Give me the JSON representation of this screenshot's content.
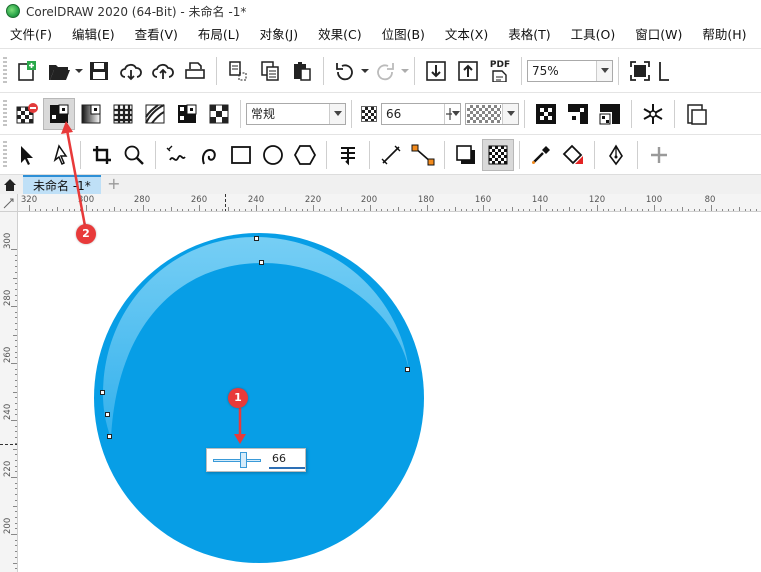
{
  "window": {
    "title": "CorelDRAW 2020 (64-Bit) - 未命名 -1*"
  },
  "menu": [
    "文件(F)",
    "编辑(E)",
    "查看(V)",
    "布局(L)",
    "对象(J)",
    "效果(C)",
    "位图(B)",
    "文本(X)",
    "表格(T)",
    "工具(O)",
    "窗口(W)",
    "帮助(H)"
  ],
  "standard_toolbar": {
    "zoom_value": "75%",
    "pdf_label": "PDF"
  },
  "property_bar": {
    "blend_mode": "常规",
    "opacity_value": "66"
  },
  "document": {
    "tab_label": "未命名 -1*"
  },
  "rulers": {
    "horizontal": [
      "320",
      "300",
      "280",
      "260",
      "240",
      "220",
      "200",
      "180",
      "160",
      "140",
      "120",
      "100",
      "80"
    ],
    "vertical": [
      "300",
      "280",
      "260",
      "240",
      "220",
      "200"
    ]
  },
  "transparency_slider": {
    "value": "66",
    "fraction": 0.66
  },
  "annotations": [
    {
      "number": "1"
    },
    {
      "number": "2"
    }
  ],
  "colors": {
    "circle_fill": "#079ee6",
    "highlight": "#5cc3f2",
    "badge": "#e83a3a",
    "accent": "#2d8fd6"
  }
}
